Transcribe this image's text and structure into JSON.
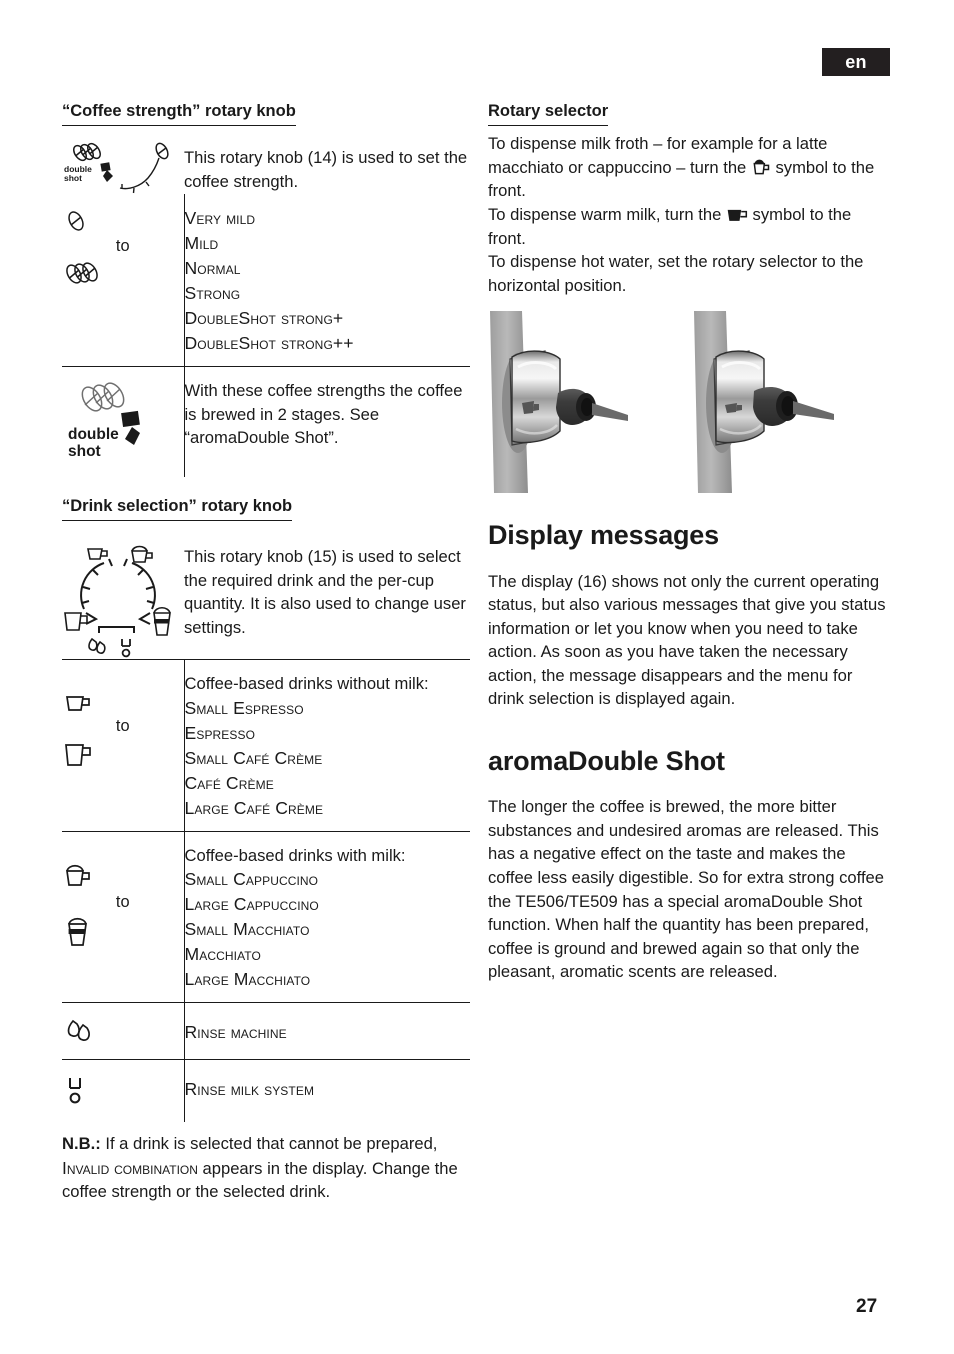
{
  "header": {
    "language_badge": "en"
  },
  "footer": {
    "page_number": "27"
  },
  "left_column": {
    "coffee_strength": {
      "heading": "“Coffee strength” rotary knob",
      "intro": "This rotary knob (14) is used to set the coffee strength.",
      "range_label": "to",
      "levels": [
        "Very mild",
        "Mild",
        "Normal",
        "Strong",
        "DoubleShot strong+",
        "DoubleShot strong++"
      ],
      "double_shot_icon_label_line1": "double",
      "double_shot_icon_label_line2": "shot",
      "double_shot_text": "With these coffee strengths the coffee is brewed in 2 stages. See “aromaDouble Shot”."
    },
    "drink_selection": {
      "heading": "“Drink selection” rotary knob",
      "intro": "This rotary knob (15) is used to select the required drink and the per-cup quantity. It is also used to change user settings.",
      "range_label": "to",
      "group_without_milk": {
        "title": "Coffee-based drinks without milk:",
        "items": [
          "Small Espresso",
          "Espresso",
          "Small Café Crème",
          "Café Crème",
          "Large Café Crème"
        ]
      },
      "group_with_milk": {
        "title": "Coffee-based drinks with milk:",
        "items": [
          "Small Cappuccino",
          "Large Cappuccino",
          "Small Macchiato",
          "Macchiato",
          "Large Macchiato"
        ]
      },
      "rinse_machine": "Rinse machine",
      "rinse_milk_system": "Rinse milk system"
    },
    "note": {
      "label": "N.B.:",
      "text_before": " If a drink is selected that cannot be prepared, ",
      "message": "Invalid combination",
      "text_after": " appears in the display. Change the coffee strength or the selected drink."
    }
  },
  "right_column": {
    "rotary_selector": {
      "heading": "Rotary selector",
      "line1_before": "To dispense milk froth – for example for a latte macchiato or cappuccino – turn the ",
      "line1_after": " symbol to the front.",
      "line2_before": "To dispense warm milk, turn the ",
      "line2_after": " symbol to the front.",
      "line3": "To dispense hot water, set the rotary selector to the horizontal position."
    },
    "display_messages": {
      "heading": "Display messages",
      "body": "The display (16) shows not only the current operating status, but also various messages that give you status information or let you know when you need to take action. As soon as you have taken the necessary action, the message disappears and the menu for drink selection is displayed again."
    },
    "aroma_double_shot": {
      "heading": "aromaDouble Shot",
      "body": "The longer the coffee is brewed, the more bitter substances and undesired aromas are released. This has a negative effect on the taste and makes the coffee less easily digestible. So for extra strong coffee the TE506/TE509 has a special aromaDouble Shot function. When half the quantity has been prepared, coffee is ground and brewed again so that only the pleasant, aromatic scents are released."
    }
  },
  "icons": {
    "one_bean": "one-bean-icon",
    "three_beans": "three-beans-icon",
    "double_shot": "double-shot-beans-icon",
    "strength_knob": "coffee-strength-knob-icon",
    "drink_knob": "drink-selection-knob-icon",
    "small_cup": "small-espresso-cup-icon",
    "large_mug": "large-cafe-creme-mug-icon",
    "cappuccino_cup": "cappuccino-cup-icon",
    "macchiato_glass": "latte-macchiato-glass-icon",
    "water_drops": "rinse-machine-drops-icon",
    "milk_rinse": "rinse-milk-system-icon",
    "milk_froth_symbol": "milk-froth-symbol-icon",
    "warm_milk_symbol": "warm-milk-symbol-icon",
    "frother_photo": "milk-frother-rotary-selector-photo"
  },
  "colors": {
    "text": "#1a1a1a",
    "badge_bg": "#231f20",
    "rule": "#1a1a1a"
  }
}
